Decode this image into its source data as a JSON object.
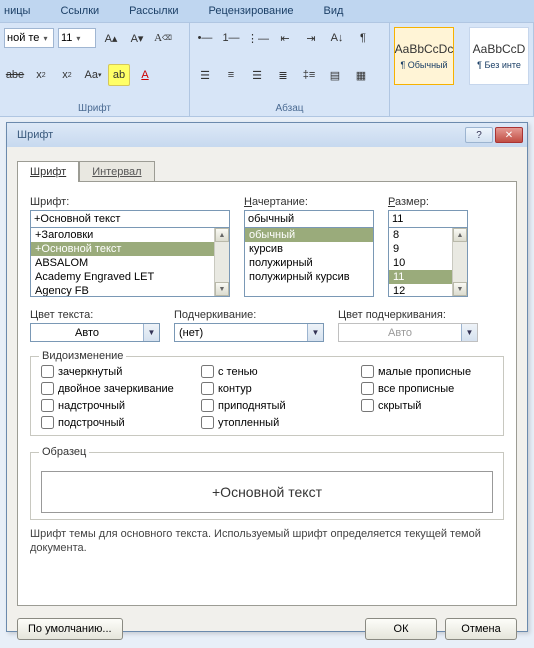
{
  "menubar": [
    "ницы",
    "Ссылки",
    "Рассылки",
    "Рецензирование",
    "Вид"
  ],
  "ribbon": {
    "font": {
      "family_display": "ной те",
      "size": "11",
      "group_title": "Шрифт"
    },
    "paragraph": {
      "group_title": "Абзац"
    },
    "styles": [
      {
        "preview": "AaBbCcDc",
        "name": "¶ Обычный",
        "sel": true
      },
      {
        "preview": "AaBbCcD",
        "name": "¶ Без инте",
        "sel": false
      }
    ]
  },
  "dialog": {
    "title": "Шрифт",
    "tabs": [
      {
        "label": "Шрифт",
        "sel": true
      },
      {
        "label": "Интервал",
        "sel": false
      }
    ],
    "font": {
      "label": "Шрифт:",
      "value": "+Основной текст",
      "options": [
        "+Заголовки",
        "+Основной текст",
        "ABSALOM",
        "Academy Engraved LET",
        "Agency FB"
      ],
      "selected_index": 1
    },
    "style": {
      "label": "Начертание:",
      "value": "обычный",
      "options": [
        "обычный",
        "курсив",
        "полужирный",
        "полужирный курсив"
      ],
      "selected_index": 0
    },
    "size": {
      "label": "Размер:",
      "value": "11",
      "options": [
        "8",
        "9",
        "10",
        "11",
        "12"
      ],
      "selected_index": 3
    },
    "color": {
      "label": "Цвет текста:",
      "value": "Авто"
    },
    "underline": {
      "label": "Подчеркивание:",
      "value": "(нет)"
    },
    "ul_color": {
      "label": "Цвет подчеркивания:",
      "value": "Авто"
    },
    "effects": {
      "legend": "Видоизменение",
      "items": [
        "зачеркнутый",
        "с тенью",
        "малые прописные",
        "двойное зачеркивание",
        "контур",
        "все прописные",
        "надстрочный",
        "приподнятый",
        "скрытый",
        "подстрочный",
        "утопленный"
      ]
    },
    "sample_label": "Образец",
    "sample_text": "+Основной текст",
    "hint": "Шрифт темы для основного текста. Используемый шрифт определяется текущей темой документа.",
    "buttons": {
      "default": "По умолчанию...",
      "ok": "ОК",
      "cancel": "Отмена"
    }
  }
}
